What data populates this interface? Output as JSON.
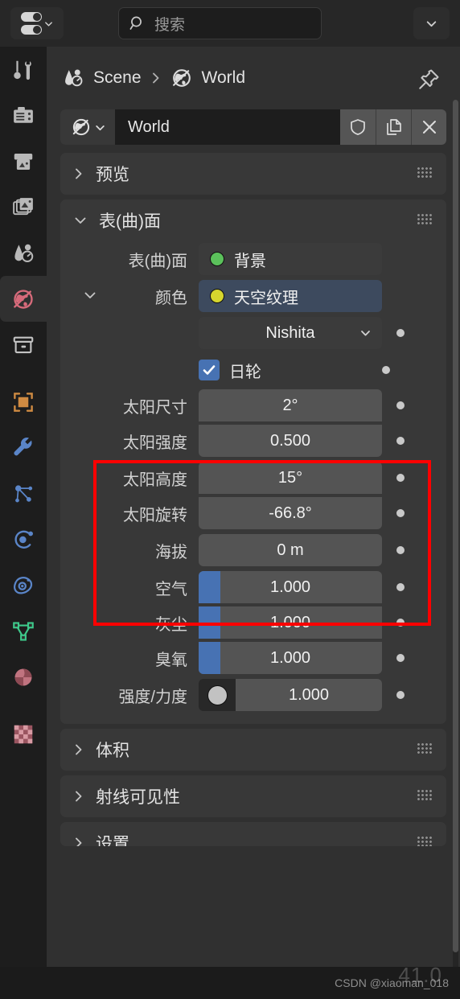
{
  "topbar": {
    "filter_icon": "toggle-filter-icon",
    "filter_chevron": "chevron-down-icon",
    "search": {
      "icon": "search-icon",
      "placeholder": "搜索",
      "value": ""
    },
    "dropdown_icon": "chevron-down-icon"
  },
  "navstrip": {
    "items": [
      {
        "name": "tool",
        "icon": "tool-icon",
        "active": false
      },
      {
        "name": "render",
        "icon": "camera-back-icon",
        "active": false
      },
      {
        "name": "output",
        "icon": "printer-icon",
        "active": false
      },
      {
        "name": "view-layer",
        "icon": "images-icon",
        "active": false
      },
      {
        "name": "scene",
        "icon": "scene-cone-icon",
        "active": false
      },
      {
        "name": "world",
        "icon": "world-globe-icon",
        "active": true
      },
      {
        "name": "collection",
        "icon": "collection-box-icon",
        "active": false
      },
      {
        "name": "object",
        "icon": "object-square-icon",
        "active": false
      },
      {
        "name": "modifiers",
        "icon": "wrench-icon",
        "active": false
      },
      {
        "name": "particles",
        "icon": "particles-icon",
        "active": false
      },
      {
        "name": "physics",
        "icon": "physics-orbit-icon",
        "active": false
      },
      {
        "name": "constraints",
        "icon": "constraint-icon",
        "active": false
      },
      {
        "name": "object-data",
        "icon": "mesh-data-icon",
        "active": false
      },
      {
        "name": "material",
        "icon": "material-sphere-icon",
        "active": false
      },
      {
        "name": "texture",
        "icon": "checker-texture-icon",
        "active": false
      }
    ]
  },
  "breadcrumb": {
    "scene_icon": "scene-cone-icon",
    "scene_label": "Scene",
    "separator": "›",
    "world_icon": "world-globe-icon",
    "world_label": "World",
    "pin_icon": "pin-icon"
  },
  "id_block": {
    "type_icon": "world-globe-icon",
    "type_chevron": "chevron-down-icon",
    "name": "World",
    "buttons": [
      {
        "name": "fake-user-button",
        "icon": "shield-icon"
      },
      {
        "name": "new-world-button",
        "icon": "duplicate-icon"
      },
      {
        "name": "unlink-button",
        "icon": "close-x-icon"
      }
    ]
  },
  "panels": {
    "preview": {
      "label": "预览",
      "expanded": false,
      "arrow": "chevron-right-icon"
    },
    "surface": {
      "label": "表(曲)面",
      "expanded": true,
      "arrow": "chevron-down-icon",
      "surface_row": {
        "label": "表(曲)面",
        "value": "背景",
        "dot_color": "#5bc15b"
      },
      "color_row": {
        "arrow": "chevron-down-icon",
        "label": "颜色",
        "value": "天空纹理",
        "dot_color": "#d6d62e",
        "highlight_color": "#3d4a5e"
      },
      "sky_type": {
        "value": "Nishita",
        "chevron": "chevron-down-icon"
      },
      "sun_disc": {
        "label": "日轮",
        "checked": true
      },
      "properties": [
        {
          "label": "太阳尺寸",
          "value": "2°",
          "type": "number",
          "group": "a"
        },
        {
          "label": "太阳强度",
          "value": "0.500",
          "type": "number",
          "group": "a"
        },
        {
          "label": "太阳高度",
          "value": "15°",
          "type": "number",
          "group": "b"
        },
        {
          "label": "太阳旋转",
          "value": "-66.8°",
          "type": "number",
          "group": "b"
        },
        {
          "label": "海拔",
          "value": "0 m",
          "type": "number",
          "group": "c"
        },
        {
          "label": "空气",
          "value": "1.000",
          "type": "slider",
          "fill": 0.12,
          "group": "d"
        },
        {
          "label": "灰尘",
          "value": "1.000",
          "type": "slider",
          "fill": 0.12,
          "group": "d"
        },
        {
          "label": "臭氧",
          "value": "1.000",
          "type": "slider",
          "fill": 0.12,
          "group": "d"
        }
      ],
      "strength_row": {
        "label": "强度/力度",
        "value": "1.000",
        "swatch": "#c2c2c2"
      }
    },
    "volume": {
      "label": "体积",
      "expanded": false,
      "arrow": "chevron-right-icon"
    },
    "ray_visibility": {
      "label": "射线可见性",
      "expanded": false,
      "arrow": "chevron-right-icon"
    },
    "settings": {
      "label": "设置",
      "expanded": false,
      "arrow": "chevron-right-icon"
    }
  },
  "annotation": {
    "type": "red-rectangle",
    "color": "#ff0000"
  },
  "statusbar": {
    "watermark": "CSDN @xiaoman_018",
    "ghost_text": "41.0"
  },
  "colors": {
    "accent_blue": "#4772b3",
    "panel_bg": "#383838",
    "region_bg": "#303030",
    "field_bg": "#545454",
    "highlight_red": "#ff0000"
  }
}
